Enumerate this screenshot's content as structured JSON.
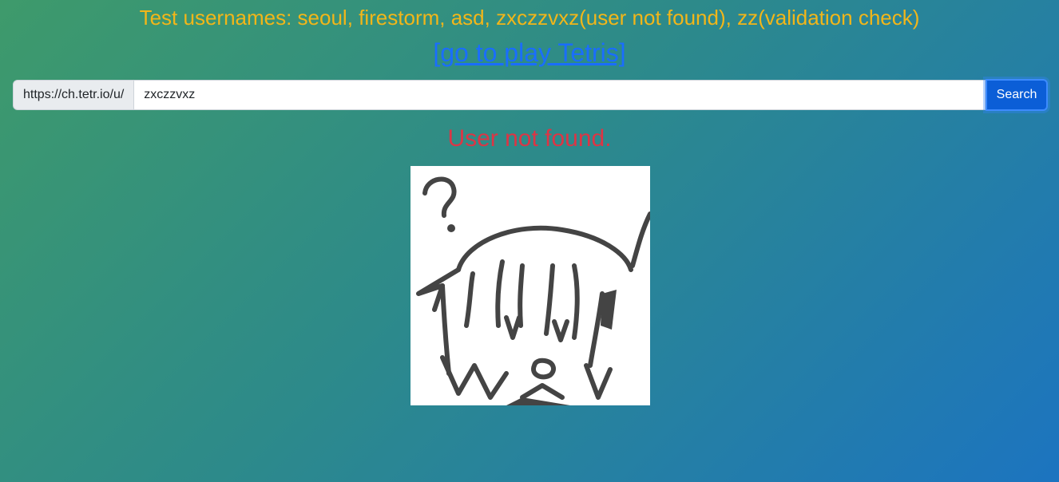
{
  "header": {
    "test_usernames": "Test usernames: seoul, firestorm, asd, zxczzvxz(user not found), zz(validation check)",
    "tetris_link": "[go to play Tetris]"
  },
  "search": {
    "prefix": "https://ch.tetr.io/u/",
    "value": "zxczzvxz",
    "button_label": "Search"
  },
  "result": {
    "message": "User not found.",
    "image_icon": "confused-chibi-drawing"
  },
  "colors": {
    "heading": "#f2b619",
    "link": "#1a6dff",
    "error": "#dc3545",
    "button": "#0b5ed7"
  }
}
